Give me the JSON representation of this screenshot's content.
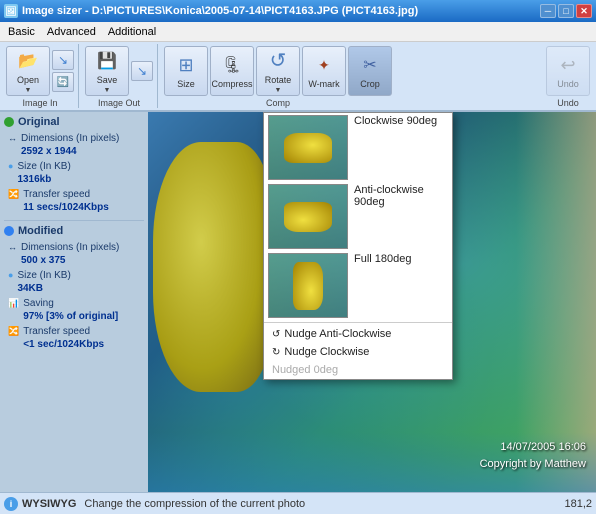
{
  "window": {
    "title": "Image sizer - D:\\PICTURES\\Konica\\2005-07-14\\PICT4163.JPG (PICT4163.jpg)",
    "controls": {
      "close": "✕",
      "minimize": "─",
      "maximize": "□"
    }
  },
  "menu": {
    "tabs": [
      "Basic",
      "Advanced",
      "Additional"
    ]
  },
  "toolbar": {
    "groups": {
      "image_in": {
        "label": "Image In",
        "buttons": [
          {
            "id": "open",
            "label": "Open",
            "icon": "open"
          },
          {
            "id": "small1",
            "label": "",
            "icon": "small"
          },
          {
            "id": "re",
            "label": "Re",
            "icon": "re"
          }
        ]
      },
      "image_out": {
        "label": "Image Out",
        "buttons": [
          {
            "id": "save",
            "label": "Save",
            "icon": "save"
          },
          {
            "id": "small2",
            "label": "",
            "icon": "small"
          }
        ]
      },
      "comp": {
        "label": "Comp",
        "buttons": [
          {
            "id": "size",
            "label": "Size",
            "icon": "size"
          },
          {
            "id": "compress",
            "label": "Compress",
            "icon": "compress"
          },
          {
            "id": "rotate",
            "label": "Rotate",
            "icon": "rotate"
          },
          {
            "id": "wmark",
            "label": "W-mark",
            "icon": "wmark"
          },
          {
            "id": "crop",
            "label": "Crop",
            "icon": "crop"
          }
        ]
      },
      "undo": {
        "label": "Undo",
        "buttons": [
          {
            "id": "undo",
            "label": "Undo",
            "icon": "undo"
          }
        ]
      }
    }
  },
  "left_panel": {
    "original": {
      "title": "Original",
      "dot_color": "#30a030",
      "dimensions_label": "Dimensions (In pixels)",
      "dimensions_value": "2592 x 1944",
      "size_label": "Size (In KB)",
      "size_value": "1316kb",
      "transfer_label": "Transfer speed",
      "transfer_value": "11 secs/1024Kbps"
    },
    "modified": {
      "title": "Modified",
      "dot_color": "#3080f0",
      "dimensions_label": "Dimensions (In pixels)",
      "dimensions_value": "500 x 375",
      "size_label": "Size (In KB)",
      "size_value": "34KB",
      "saving_label": "Saving",
      "saving_value": "97% [3% of original]",
      "transfer_label": "Transfer speed",
      "transfer_value": "<1 sec/1024Kbps"
    }
  },
  "dropdown": {
    "items": [
      {
        "id": "cw90",
        "label": "Clockwise 90deg",
        "has_thumb": true
      },
      {
        "id": "ccw90",
        "label": "Anti-clockwise 90deg",
        "has_thumb": true
      },
      {
        "id": "full180",
        "label": "Full 180deg",
        "has_thumb": true
      }
    ],
    "text_items": [
      {
        "id": "nudge_ccw",
        "label": "Nudge Anti-Clockwise",
        "disabled": false
      },
      {
        "id": "nudge_cw",
        "label": "Nudge Clockwise",
        "disabled": false
      },
      {
        "id": "nudged_0",
        "label": "Nudged 0deg",
        "disabled": true
      }
    ]
  },
  "image": {
    "timestamp": "14/07/2005 16:06",
    "copyright": "Copyright by Matthew"
  },
  "status_bar": {
    "icon_label": "i",
    "wysiwyg_label": "WYSIWYG",
    "message": "Change the compression of the current photo",
    "coords": "181,2"
  }
}
